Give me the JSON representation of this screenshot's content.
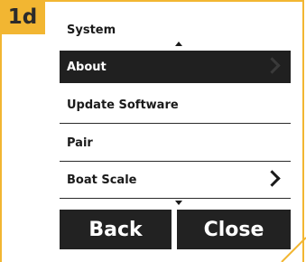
{
  "step": {
    "label": "1d"
  },
  "menu": {
    "title": "System",
    "items": [
      {
        "label": "About",
        "selected": true,
        "chevron": true
      },
      {
        "label": "Update Software",
        "selected": false,
        "chevron": false
      },
      {
        "label": "Pair",
        "selected": false,
        "chevron": false
      },
      {
        "label": "Boat Scale",
        "selected": false,
        "chevron": true
      }
    ]
  },
  "buttons": {
    "back": "Back",
    "close": "Close"
  },
  "colors": {
    "accent": "#f2b632",
    "dark": "#202020",
    "text": "#1a1a1a"
  },
  "icons": {
    "chevron": "chevron-right-icon",
    "up": "scroll-up-icon",
    "down": "scroll-down-icon"
  }
}
